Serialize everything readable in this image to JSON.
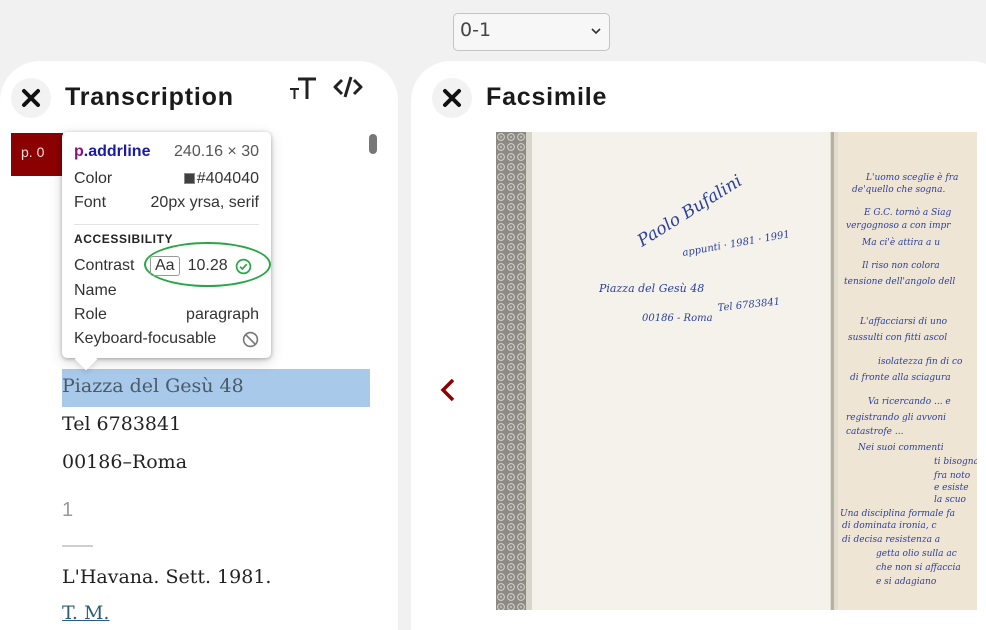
{
  "page_select": {
    "value": "0-1"
  },
  "transcription": {
    "title": "Transcription",
    "page_marker": "p. 0",
    "lines": {
      "highlighted": "Piazza del Gesù 48",
      "tel": "Tel 6783841",
      "city": "00186–Roma"
    },
    "page_number": "1",
    "after": {
      "place_date": "L'Havana. Sett. 1981.",
      "initials": "T. M."
    }
  },
  "tooltip": {
    "tag": "p",
    "class": ".addrline",
    "dimensions": "240.16 × 30",
    "color_label": "Color",
    "color_value": "#404040",
    "font_label": "Font",
    "font_value": "20px yrsa, serif",
    "section": "ACCESSIBILITY",
    "contrast_label": "Contrast",
    "contrast_aa": "Aa",
    "contrast_value": "10.28",
    "name_label": "Name",
    "role_label": "Role",
    "role_value": "paragraph",
    "keyboard_label": "Keyboard-focusable"
  },
  "facsimile": {
    "title": "Facsimile",
    "handwriting_left": [
      "Paolo Bufalini",
      "appunti · 1981 · 1991",
      "Piazza del Gesù 48",
      "Tel 6783841",
      "00186 - Roma"
    ],
    "handwriting_right": [
      "L'uomo sceglie è fra",
      "de'quello che sogna.",
      "E G.C. tornò a Siag",
      "vergognoso a con impr",
      "Ma ci'è attira a u",
      "Il riso non colora",
      "tensione dell'angolo dell",
      "L'affacciarsi di uno",
      "sussulti con fitti ascol",
      "isolatezza fin di co",
      "di fronte alla sciagura",
      "Va ricercando ... e",
      "registrando gli avvoni",
      "catastrofe ...",
      "Nei suoi commenti",
      "ti bisogna",
      "fra noto",
      "e esiste",
      "la scuo",
      "Una disciplina formale fa",
      "di dominata ironia, c",
      "di decisa resistenza a",
      "getta olio sulla ac",
      "che non si affaccia",
      "e si adagiano"
    ],
    "colors": {
      "paper": "#f4f2ea",
      "ink": "#2b3f9e",
      "accent": "#8b0000"
    }
  }
}
